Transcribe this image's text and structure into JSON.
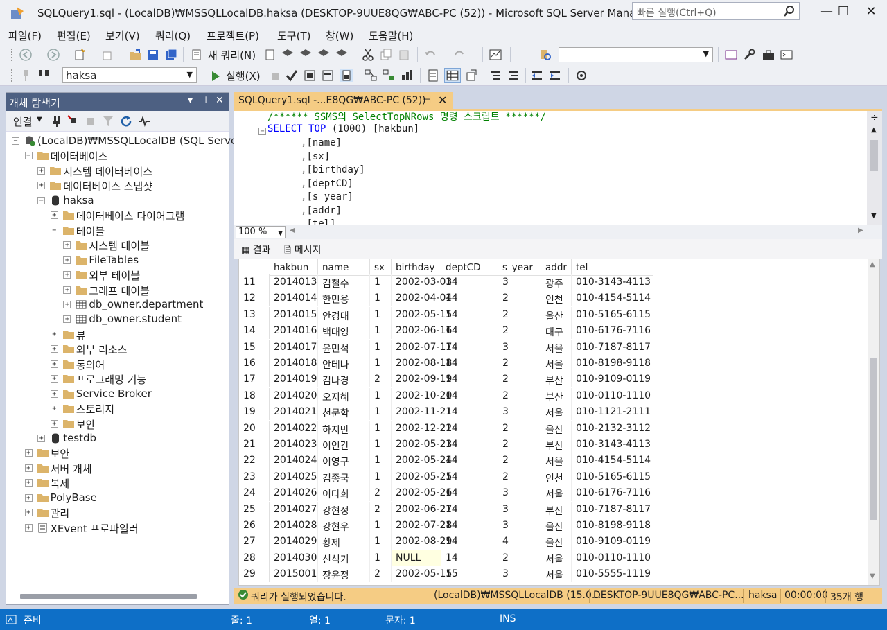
{
  "window": {
    "title": "SQLQuery1.sql - (LocalDB)₩MSSQLLocalDB.haksa (DESKTOP-9UUE8QG₩ABC-PC (52)) - Microsoft SQL Server Management St...",
    "quick_launch_placeholder": "빠른 실행(Ctrl+Q)",
    "minimize": "—",
    "maximize": "☐",
    "close": "✕"
  },
  "menu": [
    "파일(F)",
    "편집(E)",
    "보기(V)",
    "쿼리(Q)",
    "프로젝트(P)",
    "도구(T)",
    "창(W)",
    "도움말(H)"
  ],
  "toolbar": {
    "new_query": "새 쿼리(N)",
    "database": "haksa",
    "execute": "실행(X)"
  },
  "object_explorer": {
    "title": "개체 탐색기",
    "connect": "연결",
    "tree": [
      {
        "label": "(LocalDB)₩MSSQLLocalDB (SQL Server 15",
        "level": 0,
        "exp": "−",
        "icon": "server"
      },
      {
        "label": "데이터베이스",
        "level": 1,
        "exp": "−",
        "icon": "folder"
      },
      {
        "label": "시스템 데이터베이스",
        "level": 2,
        "exp": "+",
        "icon": "folder"
      },
      {
        "label": "데이터베이스 스냅샷",
        "level": 2,
        "exp": "+",
        "icon": "folder"
      },
      {
        "label": "haksa",
        "level": 2,
        "exp": "−",
        "icon": "db"
      },
      {
        "label": "데이터베이스 다이어그램",
        "level": 3,
        "exp": "+",
        "icon": "folder"
      },
      {
        "label": "테이블",
        "level": 3,
        "exp": "−",
        "icon": "folder"
      },
      {
        "label": "시스템 테이블",
        "level": 4,
        "exp": "+",
        "icon": "folder"
      },
      {
        "label": "FileTables",
        "level": 4,
        "exp": "+",
        "icon": "folder"
      },
      {
        "label": "외부 테이블",
        "level": 4,
        "exp": "+",
        "icon": "folder"
      },
      {
        "label": "그래프 테이블",
        "level": 4,
        "exp": "+",
        "icon": "folder"
      },
      {
        "label": "db_owner.department",
        "level": 4,
        "exp": "+",
        "icon": "table"
      },
      {
        "label": "db_owner.student",
        "level": 4,
        "exp": "+",
        "icon": "table"
      },
      {
        "label": "뷰",
        "level": 3,
        "exp": "+",
        "icon": "folder"
      },
      {
        "label": "외부 리소스",
        "level": 3,
        "exp": "+",
        "icon": "folder"
      },
      {
        "label": "동의어",
        "level": 3,
        "exp": "+",
        "icon": "folder"
      },
      {
        "label": "프로그래밍 기능",
        "level": 3,
        "exp": "+",
        "icon": "folder"
      },
      {
        "label": "Service Broker",
        "level": 3,
        "exp": "+",
        "icon": "folder"
      },
      {
        "label": "스토리지",
        "level": 3,
        "exp": "+",
        "icon": "folder"
      },
      {
        "label": "보안",
        "level": 3,
        "exp": "+",
        "icon": "folder"
      },
      {
        "label": "testdb",
        "level": 2,
        "exp": "+",
        "icon": "db"
      },
      {
        "label": "보안",
        "level": 1,
        "exp": "+",
        "icon": "folder"
      },
      {
        "label": "서버 개체",
        "level": 1,
        "exp": "+",
        "icon": "folder"
      },
      {
        "label": "복제",
        "level": 1,
        "exp": "+",
        "icon": "folder"
      },
      {
        "label": "PolyBase",
        "level": 1,
        "exp": "+",
        "icon": "folder"
      },
      {
        "label": "관리",
        "level": 1,
        "exp": "+",
        "icon": "folder"
      },
      {
        "label": "XEvent 프로파일러",
        "level": 1,
        "exp": "+",
        "icon": "xevent"
      }
    ]
  },
  "document_tab": {
    "label": "SQLQuery1.sql -...E8QG₩ABC-PC (52))"
  },
  "editor": {
    "comment": "/****** SSMS의 SelectTopNRows 명령 스크립트 ******/",
    "select_kw": "SELECT",
    "top_kw": "TOP",
    "top_rest": " (1000) [hakbun]",
    "columns": [
      ",[name]",
      ",[sx]",
      ",[birthday]",
      ",[deptCD]",
      ",[s_year]",
      ",[addr]",
      ",[tel]"
    ]
  },
  "zoom": "100 %",
  "results_tabs": {
    "results": "결과",
    "messages": "메시지"
  },
  "grid": {
    "columns": [
      "hakbun",
      "name",
      "sx",
      "birthday",
      "deptCD",
      "s_year",
      "addr",
      "tel"
    ],
    "rows": [
      [
        "11",
        "2014013",
        "김철수",
        "1",
        "2002-03-03",
        "14",
        "3",
        "광주",
        "010-3143-4113"
      ],
      [
        "12",
        "2014014",
        "한민용",
        "1",
        "2002-04-04",
        "14",
        "2",
        "인천",
        "010-4154-5114"
      ],
      [
        "13",
        "2014015",
        "안경태",
        "1",
        "2002-05-15",
        "14",
        "2",
        "울산",
        "010-5165-6115"
      ],
      [
        "14",
        "2014016",
        "백대영",
        "1",
        "2002-06-16",
        "14",
        "2",
        "대구",
        "010-6176-7116"
      ],
      [
        "15",
        "2014017",
        "윤민석",
        "1",
        "2002-07-17",
        "14",
        "3",
        "서울",
        "010-7187-8117"
      ],
      [
        "16",
        "2014018",
        "안테나",
        "1",
        "2002-08-18",
        "14",
        "2",
        "서울",
        "010-8198-9118"
      ],
      [
        "17",
        "2014019",
        "김나경",
        "2",
        "2002-09-19",
        "14",
        "2",
        "부산",
        "010-9109-0119"
      ],
      [
        "18",
        "2014020",
        "오지혜",
        "1",
        "2002-10-20",
        "14",
        "2",
        "부산",
        "010-0110-1110"
      ],
      [
        "19",
        "2014021",
        "천문학",
        "1",
        "2002-11-21",
        "14",
        "3",
        "서울",
        "010-1121-2111"
      ],
      [
        "20",
        "2014022",
        "하지만",
        "1",
        "2002-12-22",
        "14",
        "2",
        "울산",
        "010-2132-3112"
      ],
      [
        "21",
        "2014023",
        "이인간",
        "1",
        "2002-05-23",
        "14",
        "2",
        "부산",
        "010-3143-4113"
      ],
      [
        "22",
        "2014024",
        "이영구",
        "1",
        "2002-05-24",
        "14",
        "2",
        "서울",
        "010-4154-5114"
      ],
      [
        "23",
        "2014025",
        "김종국",
        "1",
        "2002-05-25",
        "14",
        "2",
        "인천",
        "010-5165-6115"
      ],
      [
        "24",
        "2014026",
        "이다희",
        "2",
        "2002-05-26",
        "14",
        "3",
        "서울",
        "010-6176-7116"
      ],
      [
        "25",
        "2014027",
        "강현정",
        "2",
        "2002-06-27",
        "14",
        "3",
        "부산",
        "010-7187-8117"
      ],
      [
        "26",
        "2014028",
        "강현우",
        "1",
        "2002-07-28",
        "14",
        "3",
        "울산",
        "010-8198-9118"
      ],
      [
        "27",
        "2014029",
        "황제",
        "1",
        "2002-08-29",
        "14",
        "4",
        "울산",
        "010-9109-0119"
      ],
      [
        "28",
        "2014030",
        "신석기",
        "1",
        "NULL",
        "14",
        "2",
        "서울",
        "010-0110-1110"
      ],
      [
        "29",
        "2015001",
        "장윤정",
        "2",
        "2002-05-15",
        "15",
        "3",
        "서울",
        "010-5555-1119"
      ]
    ]
  },
  "query_status": {
    "message": "쿼리가 실행되었습니다.",
    "server": "(LocalDB)₩MSSQLLocalDB (15.0...",
    "user": "DESKTOP-9UUE8QG₩ABC-PC...",
    "database": "haksa",
    "time": "00:00:00",
    "rows": "35개 행"
  },
  "statusbar": {
    "ready": "준비",
    "line": "줄: 1",
    "col": "열: 1",
    "char": "문자: 1",
    "mode": "INS"
  },
  "colors": {
    "accent_tab": "#f5cc84",
    "status_blue": "#0e6fc7",
    "panel_header": "#4d6082"
  }
}
